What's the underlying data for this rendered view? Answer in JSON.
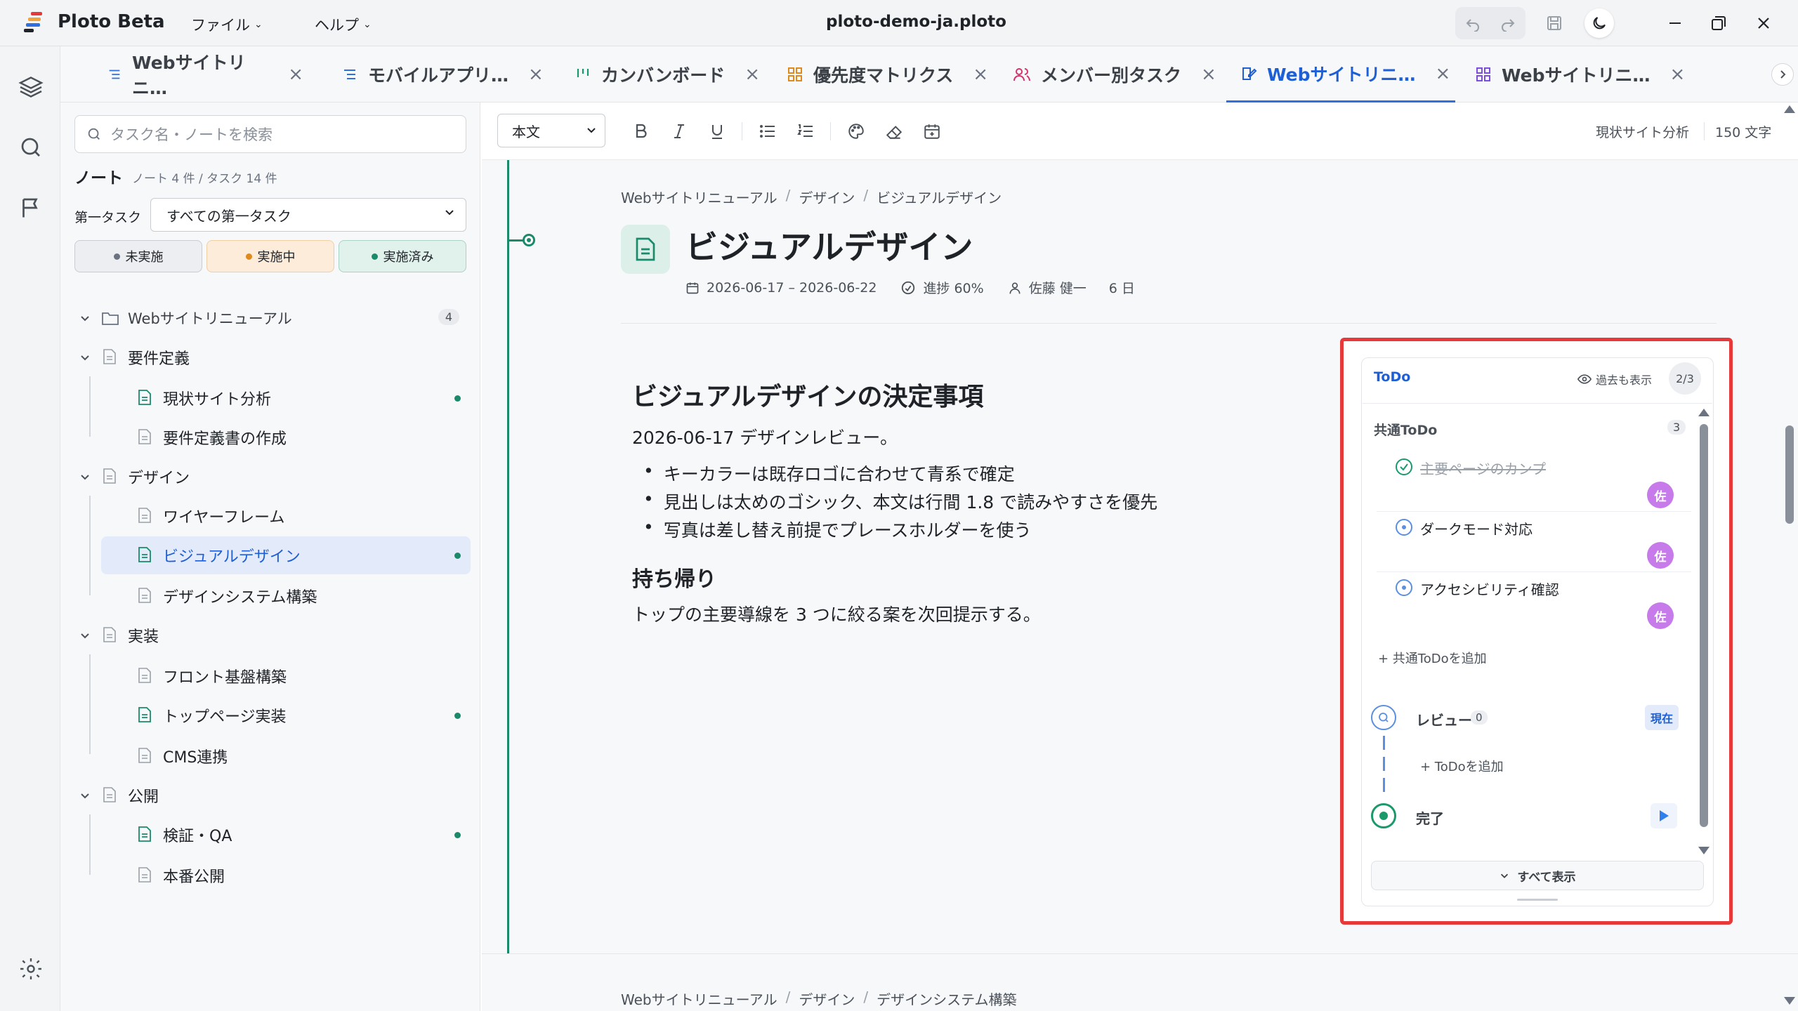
{
  "app": {
    "name": "Ploto Beta",
    "window_title": "ploto-demo-ja.ploto",
    "menus": [
      "ファイル",
      "ヘルプ"
    ]
  },
  "tabs": [
    {
      "label": "Webサイトリニ…",
      "icon": "list-icon",
      "color": "#2f6fe0"
    },
    {
      "label": "モバイルアプリ…",
      "icon": "list-icon",
      "color": "#2f6fe0"
    },
    {
      "label": "カンバンボード",
      "icon": "kanban-icon",
      "color": "#1a9a6b"
    },
    {
      "label": "優先度マトリクス",
      "icon": "grid-icon",
      "color": "#e08a1e"
    },
    {
      "label": "メンバー別タスク",
      "icon": "users-icon",
      "color": "#d6336c"
    },
    {
      "label": "Webサイトリニ…",
      "icon": "note-icon",
      "color": "#1e5fd6",
      "active": true
    },
    {
      "label": "Webサイトリニ…",
      "icon": "grid-icon",
      "color": "#7c4ddf"
    }
  ],
  "sidebar": {
    "search_placeholder": "タスク名・ノートを検索",
    "section_title": "ノート",
    "section_count": "ノート 4 件 / タスク 14 件",
    "filter_label": "第一タスク",
    "filter_value": "すべての第一タスク",
    "status_pills": [
      {
        "label": "未実施",
        "dot": "#6b7280",
        "bg": "#eceef1",
        "border": "#c9ccd1"
      },
      {
        "label": "実施中",
        "dot": "#e08a1e",
        "bg": "#fcecd9",
        "border": "#efcfa6"
      },
      {
        "label": "実施済み",
        "dot": "#1a8a6b",
        "bg": "#e1f1ec",
        "border": "#a9d3c5"
      }
    ],
    "root": {
      "label": "Webサイトリニューアル",
      "count": "4"
    },
    "groups": [
      {
        "label": "要件定義",
        "items": [
          {
            "label": "現状サイト分析",
            "has_note": true
          },
          {
            "label": "要件定義書の作成",
            "has_note": false
          }
        ]
      },
      {
        "label": "デザイン",
        "items": [
          {
            "label": "ワイヤーフレーム",
            "has_note": false
          },
          {
            "label": "ビジュアルデザイン",
            "has_note": true,
            "selected": true
          },
          {
            "label": "デザインシステム構築",
            "has_note": false
          }
        ]
      },
      {
        "label": "実装",
        "items": [
          {
            "label": "フロント基盤構築",
            "has_note": false
          },
          {
            "label": "トップページ実装",
            "has_note": true
          },
          {
            "label": "CMS連携",
            "has_note": false
          }
        ]
      },
      {
        "label": "公開",
        "items": [
          {
            "label": "検証・QA",
            "has_note": true
          },
          {
            "label": "本番公開",
            "has_note": false
          }
        ]
      }
    ]
  },
  "toolbar": {
    "style_select": "本文",
    "right_context": "現状サイト分析",
    "char_count": "150 文字"
  },
  "note": {
    "breadcrumb": [
      "Webサイトリニューアル",
      "デザイン",
      "ビジュアルデザイン"
    ],
    "title": "ビジュアルデザイン",
    "dates": "2026-06-17 – 2026-06-22",
    "progress": "進捗 60%",
    "assignee": "佐藤 健一",
    "duration": "6 日",
    "h1": "ビジュアルデザインの決定事項",
    "p1": "2026-06-17 デザインレビュー。",
    "bullets": [
      "キーカラーは既存ロゴに合わせて青系で確定",
      "見出しは太めのゴシック、本文は行間 1.8 で読みやすさを優先",
      "写真は差し替え前提でプレースホルダーを使う"
    ],
    "h2": "持ち帰り",
    "p2": "トップの主要導線を 3 つに絞る案を次回提示する。",
    "next_breadcrumb": [
      "Webサイトリニューアル",
      "デザイン",
      "デザインシステム構築"
    ]
  },
  "todo": {
    "title": "ToDo",
    "show_past": "過去も表示",
    "counter": "2/3",
    "shared_title": "共通ToDo",
    "shared_count": "3",
    "items": [
      {
        "label": "主要ページのカンプ",
        "done": true,
        "avatar": "佐"
      },
      {
        "label": "ダークモード対応",
        "done": false,
        "avatar": "佐"
      },
      {
        "label": "アクセシビリティ確認",
        "done": false,
        "avatar": "佐"
      }
    ],
    "add_shared": "+ 共通ToDoを追加",
    "review_label": "レビュー",
    "review_count": "0",
    "current_badge": "現在",
    "add_todo": "+ ToDoを追加",
    "done_label": "完了",
    "show_all": "すべて表示"
  }
}
